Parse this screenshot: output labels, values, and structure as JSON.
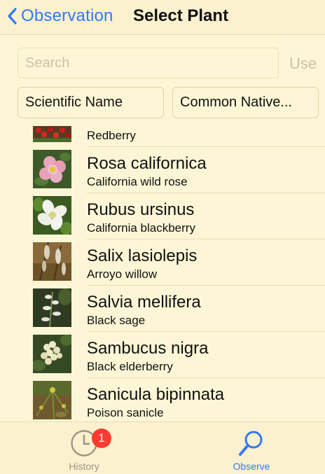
{
  "navbar": {
    "back_label": "Observation",
    "title": "Select Plant"
  },
  "search": {
    "placeholder": "Search",
    "value": "",
    "use_label": "Use"
  },
  "sort_buttons": {
    "scientific": "Scientific Name",
    "common": "Common Native..."
  },
  "plants": [
    {
      "scientific": "",
      "common": "Redberry",
      "thumb_icon": "red-berry-photo"
    },
    {
      "scientific": "Rosa californica",
      "common": "California wild rose",
      "thumb_icon": "pink-rose-photo"
    },
    {
      "scientific": "Rubus ursinus",
      "common": "California blackberry",
      "thumb_icon": "white-flower-photo"
    },
    {
      "scientific": "Salix lasiolepis",
      "common": "Arroyo willow",
      "thumb_icon": "willow-catkin-photo"
    },
    {
      "scientific": "Salvia mellifera",
      "common": "Black sage",
      "thumb_icon": "sage-flower-photo"
    },
    {
      "scientific": "Sambucus nigra",
      "common": "Black elderberry",
      "thumb_icon": "elderberry-flower-photo"
    },
    {
      "scientific": "Sanicula bipinnata",
      "common": "Poison sanicle",
      "thumb_icon": "sanicle-photo"
    }
  ],
  "tabbar": {
    "history": {
      "label": "History",
      "badge": "1",
      "icon": "clock-icon"
    },
    "observe": {
      "label": "Observe",
      "icon": "magnifier-icon"
    }
  },
  "colors": {
    "accent": "#3478f6",
    "background": "#fdf6d6",
    "badge": "#ff3b30"
  }
}
